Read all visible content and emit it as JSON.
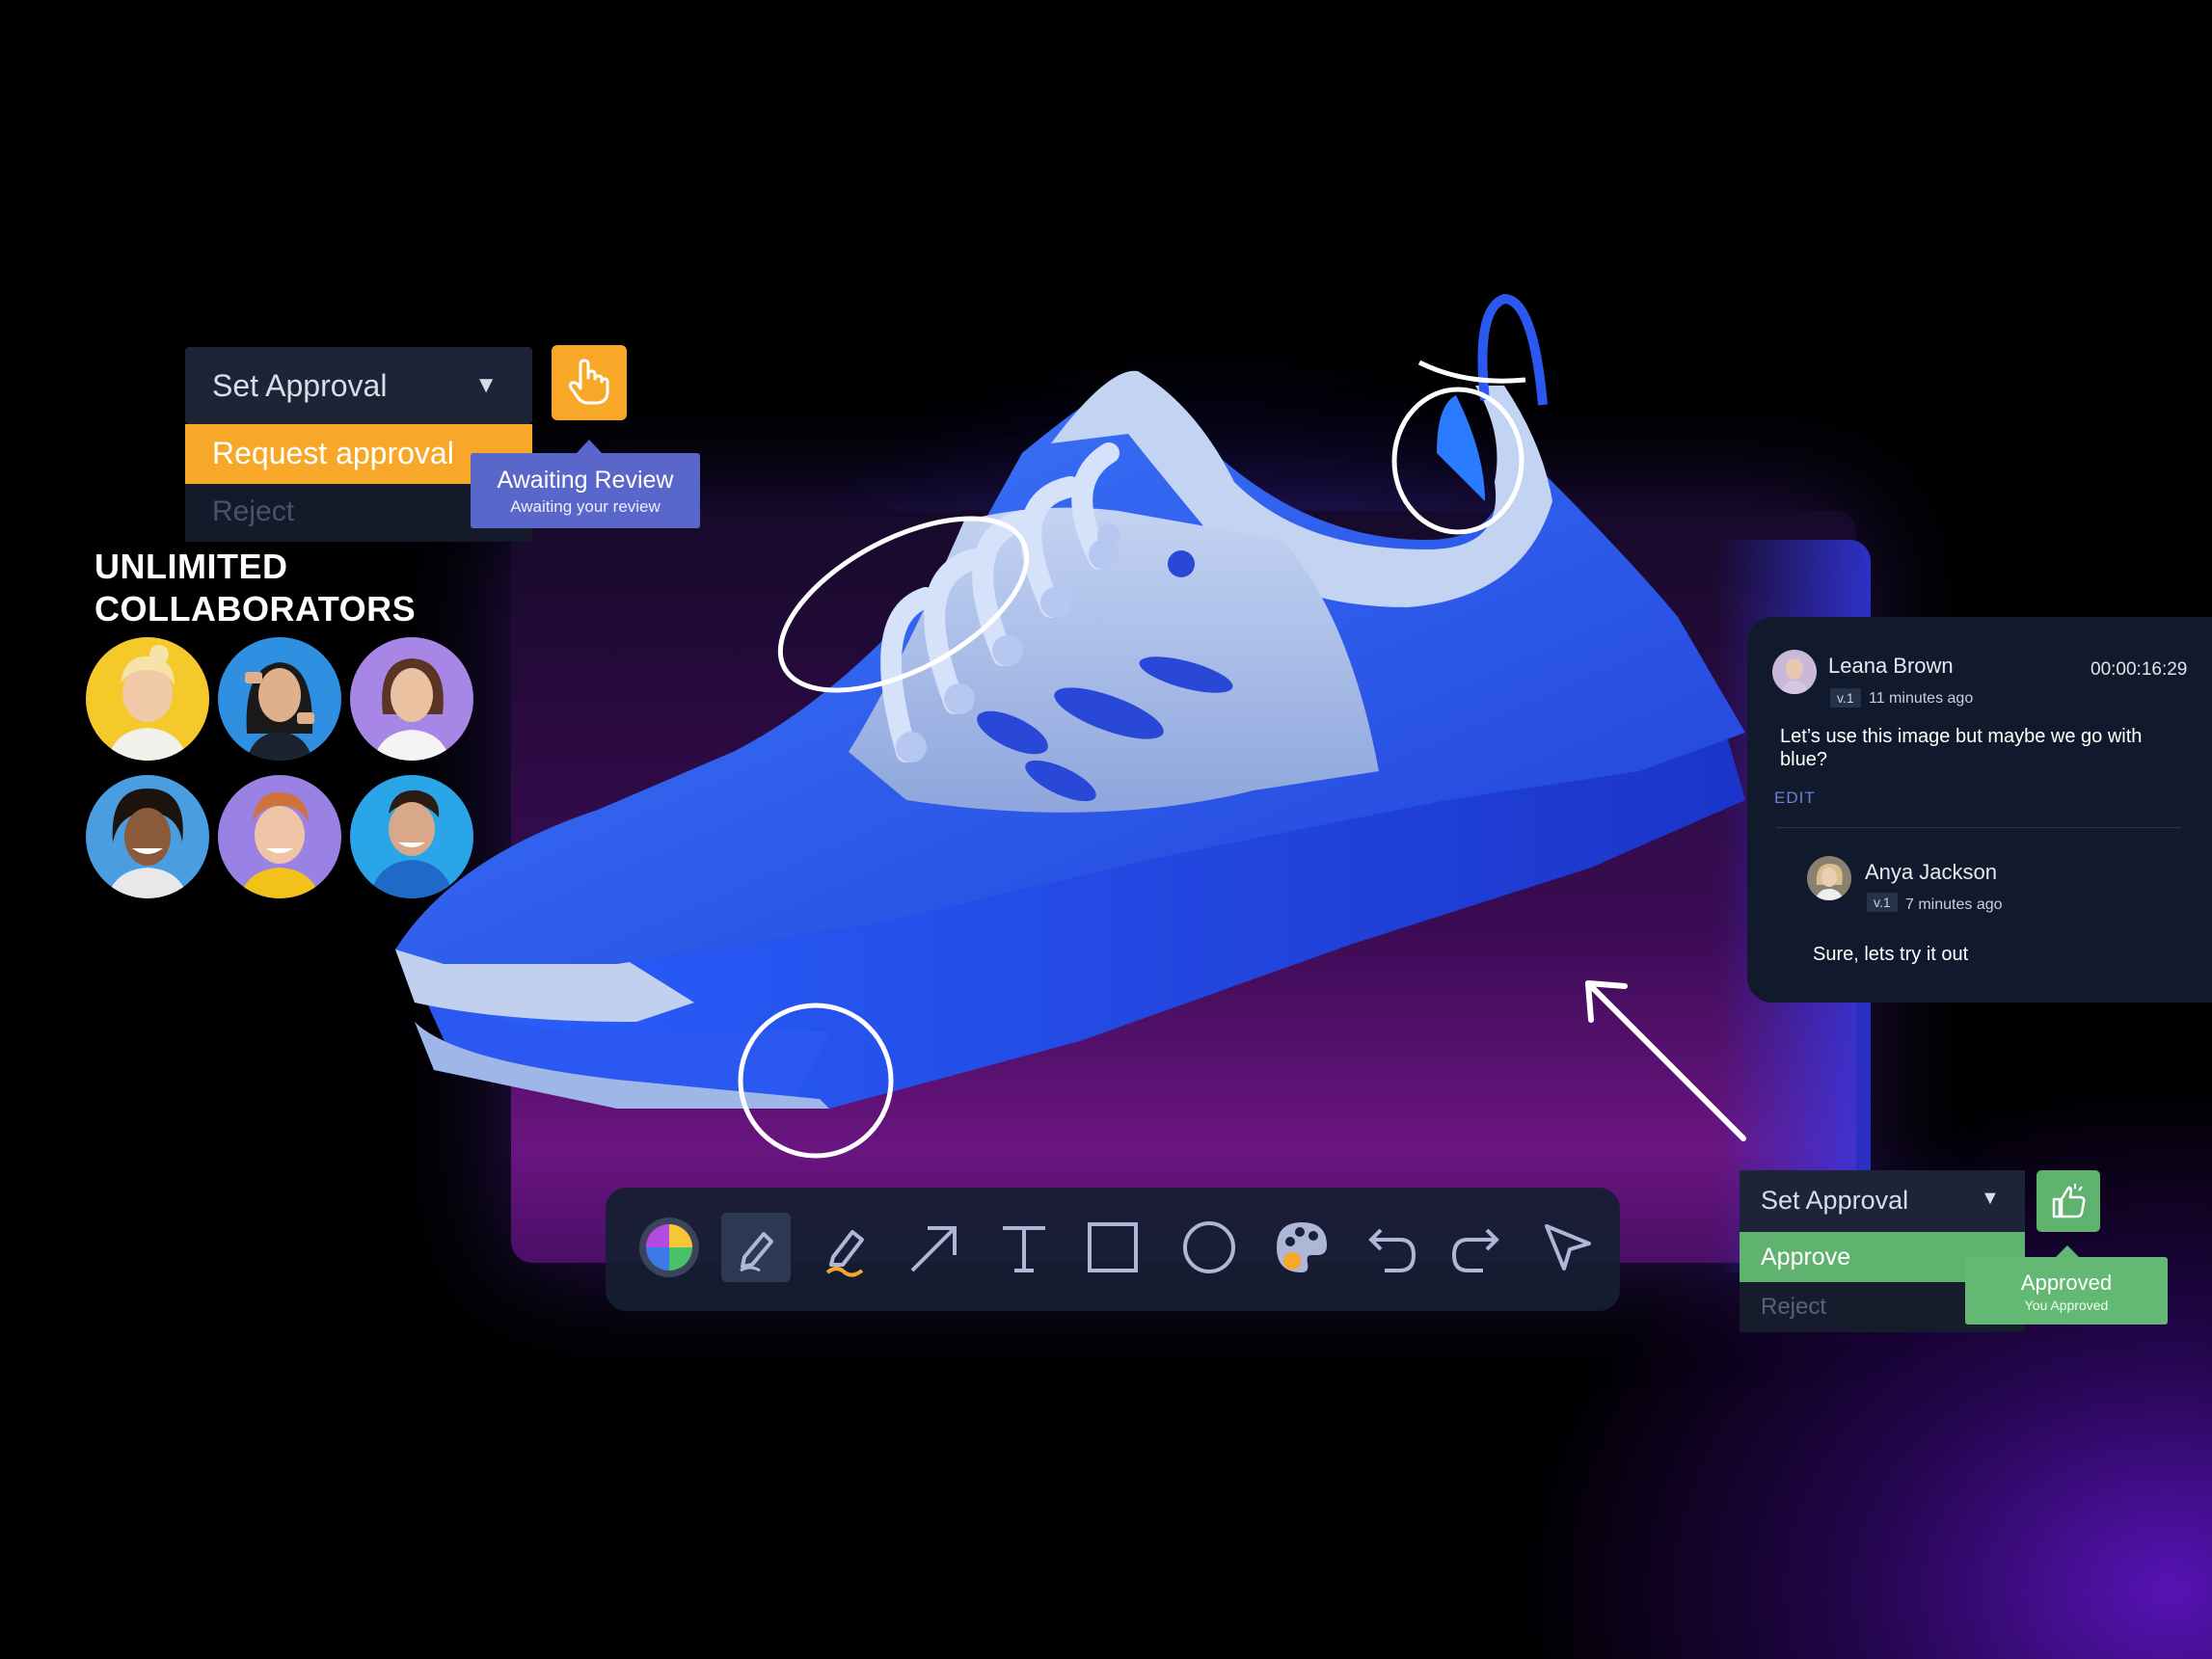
{
  "approval_top": {
    "header_label": "Set Approval",
    "option_request": "Request approval",
    "option_reject": "Reject",
    "tooltip_title": "Awaiting Review",
    "tooltip_subtitle": "Awaiting your review",
    "accent": "#f7a828"
  },
  "collaborators": {
    "title_line1": "UNLIMITED",
    "title_line2": "COLLABORATORS"
  },
  "comments": {
    "first": {
      "author": "Leana Brown",
      "timestamp": "00:00:16:29",
      "version": "v.1",
      "ago": "11 minutes ago",
      "text_line1": "Let’s use this image but maybe we go with",
      "text_line2": "blue?",
      "edit_label": "EDIT"
    },
    "reply": {
      "author": "Anya Jackson",
      "version": "v.1",
      "ago": "7 minutes ago",
      "text": "Sure, lets try it out"
    }
  },
  "approval_bottom": {
    "header_label": "Set Approval",
    "option_approve": "Approve",
    "option_reject": "Reject",
    "tooltip_title": "Approved",
    "tooltip_subtitle": "You Approved",
    "accent": "#5fb36e"
  },
  "toolbar": {
    "tools": [
      "color-wheel",
      "pen",
      "highlighter",
      "arrow",
      "text",
      "rectangle",
      "ellipse",
      "palette",
      "undo",
      "redo",
      "pointer"
    ],
    "active_tool": "pen"
  }
}
